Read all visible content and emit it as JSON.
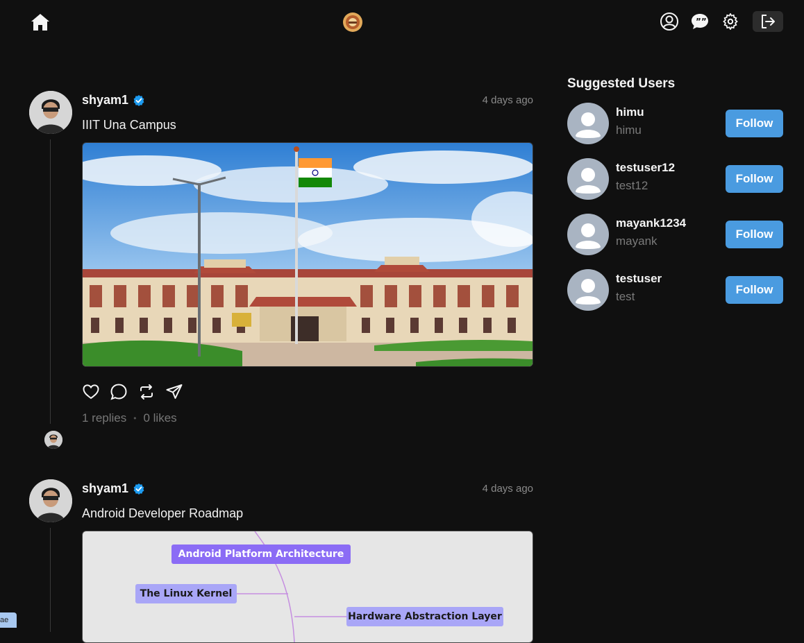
{
  "header": {
    "home_icon": "home-icon",
    "logo_icon": "institute-logo",
    "icons": [
      "profile-icon",
      "chat-icon",
      "settings-icon",
      "logout-icon"
    ]
  },
  "posts": [
    {
      "username": "shyam1",
      "time": "4 days ago",
      "text": "IIIT Una Campus",
      "replies": "1 replies",
      "likes": "0 likes"
    },
    {
      "username": "shyam1",
      "time": "4 days ago",
      "text": "Android Developer Roadmap",
      "roadmap_nodes": [
        "Android Platform Architecture",
        "The Linux Kernel",
        "Hardware Abstraction Layer"
      ]
    }
  ],
  "sidebar": {
    "title": "Suggested Users",
    "follow_label": "Follow",
    "users": [
      {
        "name": "himu",
        "handle": "himu"
      },
      {
        "name": "testuser12",
        "handle": "test12"
      },
      {
        "name": "mayank1234",
        "handle": "mayank"
      },
      {
        "name": "testuser",
        "handle": "test"
      }
    ]
  },
  "corner_tab": "ae",
  "colors": {
    "background": "#101010",
    "accent": "#4a9be0",
    "verified": "#1d9bf0"
  }
}
